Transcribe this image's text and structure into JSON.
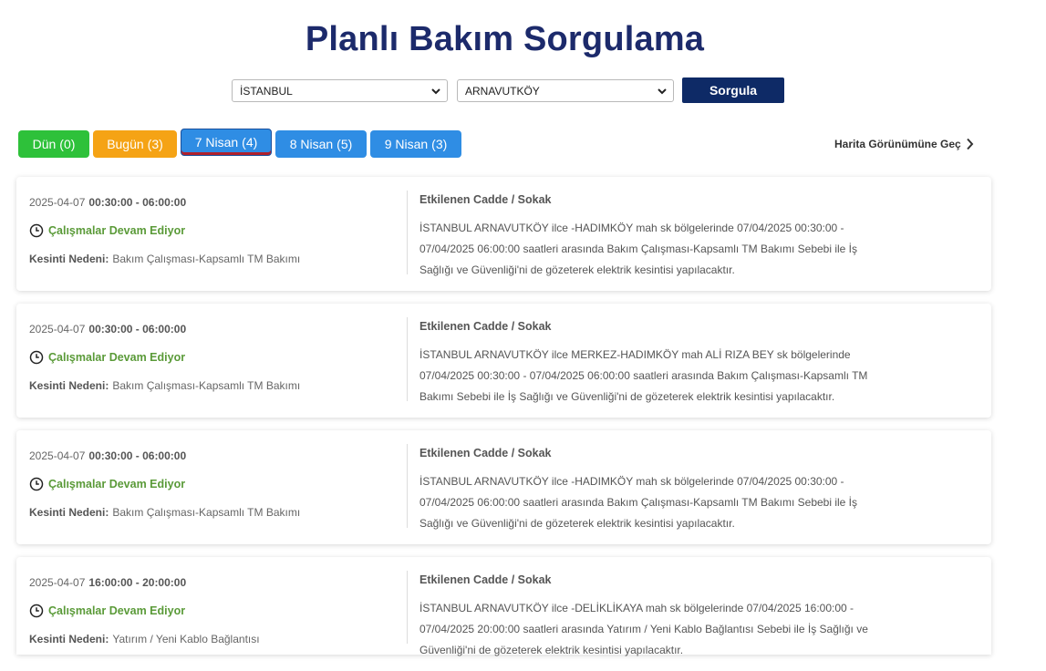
{
  "page": {
    "title": "Planlı Bakım Sorgulama"
  },
  "filters": {
    "province": "İSTANBUL",
    "district": "ARNAVUTKÖY",
    "query_button": "Sorgula"
  },
  "tabs": [
    {
      "label": "Dün",
      "count": "(0)",
      "color": "#2ec13a"
    },
    {
      "label": "Bugün",
      "count": "(3)",
      "color": "#f5a315"
    },
    {
      "label": "7 Nisan",
      "count": "(4)",
      "color": "#2f8de4",
      "active": true
    },
    {
      "label": "8 Nisan",
      "count": "(5)",
      "color": "#2f8de4"
    },
    {
      "label": "9 Nisan",
      "count": "(3)",
      "color": "#2f8de4"
    }
  ],
  "map_link": "Harita Görünümüne Geç",
  "cards": [
    {
      "date": "2025-04-07",
      "time_range": "00:30:00 - 06:00:00",
      "status": "Çalışmalar Devam Ediyor",
      "reason_label": "Kesinti Nedeni:",
      "reason": "Bakım Çalışması-Kapsamlı TM Bakımı",
      "affected_label": "Etkilenen Cadde / Sokak",
      "lines": [
        "İSTANBUL ARNAVUTKÖY ilce -HADIMKÖY mah sk bölgelerinde 07/04/2025 00:30:00 -",
        "07/04/2025 06:00:00 saatleri arasında Bakım Çalışması-Kapsamlı TM Bakımı Sebebi ile İş",
        "Sağlığı ve Güvenliği'ni de gözeterek elektrik kesintisi yapılacaktır."
      ]
    },
    {
      "date": "2025-04-07",
      "time_range": "00:30:00 - 06:00:00",
      "status": "Çalışmalar Devam Ediyor",
      "reason_label": "Kesinti Nedeni:",
      "reason": "Bakım Çalışması-Kapsamlı TM Bakımı",
      "affected_label": "Etkilenen Cadde / Sokak",
      "lines": [
        "İSTANBUL ARNAVUTKÖY ilce MERKEZ-HADIMKÖY mah ALİ RIZA BEY sk bölgelerinde",
        "07/04/2025 00:30:00 - 07/04/2025 06:00:00 saatleri arasında Bakım Çalışması-Kapsamlı TM",
        "Bakımı Sebebi ile İş Sağlığı ve Güvenliği'ni de gözeterek elektrik kesintisi yapılacaktır."
      ]
    },
    {
      "date": "2025-04-07",
      "time_range": "00:30:00 - 06:00:00",
      "status": "Çalışmalar Devam Ediyor",
      "reason_label": "Kesinti Nedeni:",
      "reason": "Bakım Çalışması-Kapsamlı TM Bakımı",
      "affected_label": "Etkilenen Cadde / Sokak",
      "lines": [
        "İSTANBUL ARNAVUTKÖY ilce -HADIMKÖY mah sk bölgelerinde 07/04/2025 00:30:00 -",
        "07/04/2025 06:00:00 saatleri arasında Bakım Çalışması-Kapsamlı TM Bakımı Sebebi ile İş",
        "Sağlığı ve Güvenliği'ni de gözeterek elektrik kesintisi yapılacaktır."
      ]
    },
    {
      "date": "2025-04-07",
      "time_range": "16:00:00 - 20:00:00",
      "status": "Çalışmalar Devam Ediyor",
      "reason_label": "Kesinti Nedeni:",
      "reason": "Yatırım / Yeni Kablo Bağlantısı",
      "affected_label": "Etkilenen Cadde / Sokak",
      "lines": [
        "İSTANBUL ARNAVUTKÖY ilce -DELİKLİKAYA mah sk bölgelerinde 07/04/2025 16:00:00 -",
        "07/04/2025 20:00:00 saatleri arasında Yatırım / Yeni Kablo Bağlantısı Sebebi ile İş Sağlığı ve",
        "Güvenliği'ni de gözeterek elektrik kesintisi yapılacaktır."
      ]
    }
  ]
}
